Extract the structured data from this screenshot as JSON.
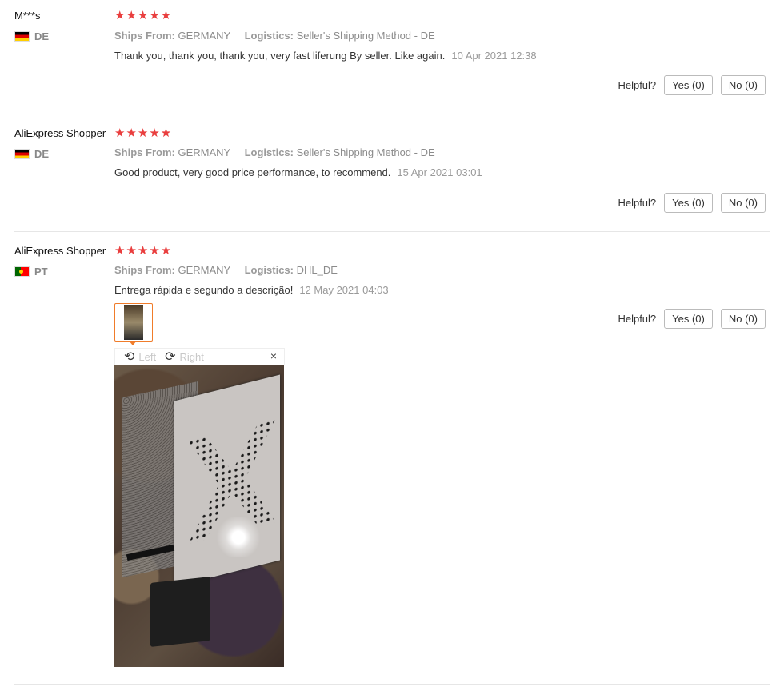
{
  "common": {
    "stars": "★★★★★",
    "ships_from_label": "Ships From:",
    "logistics_label": "Logistics:",
    "helpful_label": "Helpful?"
  },
  "reviews": [
    {
      "user": "M***s",
      "country": "DE",
      "ships_from": "GERMANY",
      "logistics": "Seller's Shipping Method - DE",
      "text": "Thank you, thank you, thank you, very fast liferung By seller. Like again.",
      "date": "10 Apr 2021 12:38",
      "yes": "Yes (0)",
      "no": "No (0)"
    },
    {
      "user": "AliExpress Shopper",
      "country": "DE",
      "ships_from": "GERMANY",
      "logistics": "Seller's Shipping Method - DE",
      "text": "Good product, very good price performance, to recommend.",
      "date": "15 Apr 2021 03:01",
      "yes": "Yes (0)",
      "no": "No (0)"
    },
    {
      "user": "AliExpress Shopper",
      "country": "PT",
      "ships_from": "GERMANY",
      "logistics": "DHL_DE",
      "text": "Entrega rápida e segundo a descrição!",
      "date": "12 May 2021 04:03",
      "yes": "Yes (0)",
      "no": "No (0)"
    }
  ],
  "viewer": {
    "rotate_left": "Left",
    "rotate_right": "Right",
    "close": "×"
  },
  "colors": {
    "star": "#e93e3e",
    "thumb_border": "#f07c2a"
  }
}
